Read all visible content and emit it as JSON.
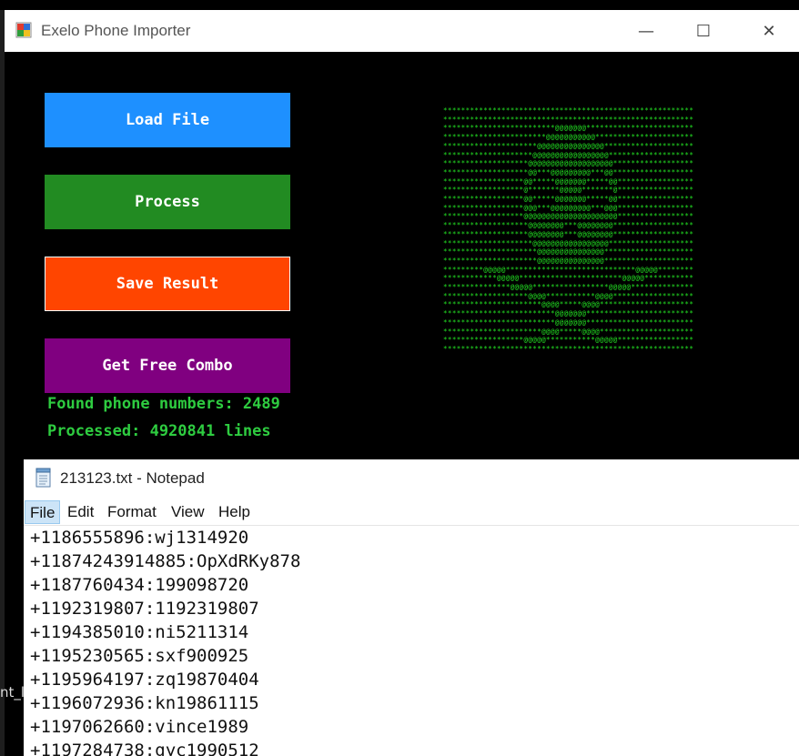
{
  "app": {
    "title": "Exelo Phone Importer"
  },
  "caption": {
    "minimize": "—",
    "maximize": "☐",
    "close": "✕"
  },
  "buttons": {
    "load": {
      "label": "Load File",
      "color": "#1e90ff"
    },
    "process": {
      "label": "Process",
      "color": "#228b22"
    },
    "save": {
      "label": "Save Result",
      "color": "#ff4500"
    },
    "combo": {
      "label": "Get Free Combo",
      "color": "#800080"
    }
  },
  "status": {
    "found": "Found phone numbers: 2489",
    "processed": "Processed: 4920841 lines"
  },
  "behind_window_text": "nt_l",
  "notepad": {
    "title": "213123.txt - Notepad",
    "menu": [
      "File",
      "Edit",
      "Format",
      "View",
      "Help"
    ],
    "lines": [
      "+1186555896:wj1314920",
      "+11874243914885:OpXdRKy878",
      "+1187760434:199098720",
      "+1192319807:1192319807",
      "+1194385010:ni5211314",
      "+1195230565:sxf900925",
      "+1195964197:zq19870404",
      "+1196072936:kn19861115",
      "+1197062660:vince1989",
      "+1197284738:gyc1990512"
    ]
  }
}
